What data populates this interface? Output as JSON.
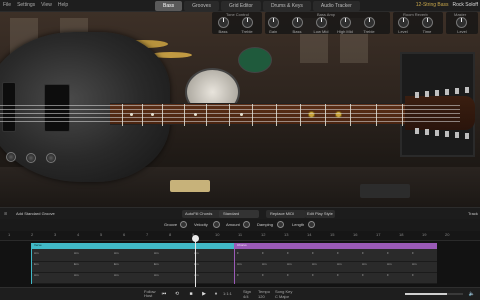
{
  "menu": {
    "file": "File",
    "settings": "Settings",
    "view": "View",
    "help": "Help"
  },
  "tabs": [
    {
      "label": "Bass",
      "active": true
    },
    {
      "label": "Grooves",
      "active": false
    },
    {
      "label": "Grid Editor",
      "active": false
    },
    {
      "label": "Drums & Keys",
      "active": false
    },
    {
      "label": "Audio Tracker",
      "active": false
    }
  ],
  "preset": {
    "name": "12-String Bass",
    "style": "Rock Soloff"
  },
  "knob_groups": [
    {
      "title": "Tone Control",
      "knobs": [
        "Bass",
        "Treble"
      ]
    },
    {
      "title": "Bass Amp",
      "knobs": [
        "Gain",
        "Bass",
        "Low Mid",
        "High Mid",
        "Treble"
      ]
    },
    {
      "title": "Room Reverb",
      "knobs": [
        "Level",
        "Time"
      ]
    },
    {
      "title": "Master",
      "knobs": [
        "Level"
      ]
    }
  ],
  "toolbar": {
    "add_groove": "Add Standard Groove",
    "autofill": "AutoFill Chords",
    "standard": "Standard",
    "replace_midi": "Replace MIDI",
    "edit_play_style": "Edit Play Style",
    "track": "Track"
  },
  "controls": {
    "groove": "Groove",
    "velocity": "Velocity",
    "amount": "Amount",
    "damping": "Damping",
    "length": "Length"
  },
  "ruler": [
    "1",
    "2",
    "3",
    "4",
    "5",
    "6",
    "7",
    "8",
    "9",
    "10",
    "11",
    "12",
    "13",
    "14",
    "15",
    "16",
    "17",
    "18",
    "19",
    "20"
  ],
  "clips": [
    {
      "name": "Verse",
      "color": "#41b9c7",
      "lanes": [
        [
          "Am",
          "Am",
          "Am",
          "Am",
          "Am"
        ],
        [
          "Em",
          "Em",
          "Em",
          "Em",
          "Em"
        ],
        [
          "Am",
          "Am",
          "Am",
          "Am",
          "Am"
        ]
      ]
    },
    {
      "name": "Chorus",
      "color": "#9a5ab7",
      "lanes": [
        [
          "F",
          "F",
          "F",
          "F",
          "F",
          "F",
          "F",
          "F"
        ],
        [
          "Am",
          "Am",
          "Am",
          "Am",
          "Am",
          "Am",
          "Am",
          "Am"
        ],
        [
          "F",
          "F",
          "F",
          "F",
          "F",
          "F",
          "F",
          "F"
        ]
      ]
    }
  ],
  "bottom": {
    "follow_host": "Follow Host",
    "sign": "Sign",
    "sign_value": "4/4",
    "tempo": "Tempo",
    "tempo_value": "120",
    "song_key": "Song Key",
    "song_key_value": "C Major",
    "timecode": "1:1:1",
    "volume": 0.72
  }
}
